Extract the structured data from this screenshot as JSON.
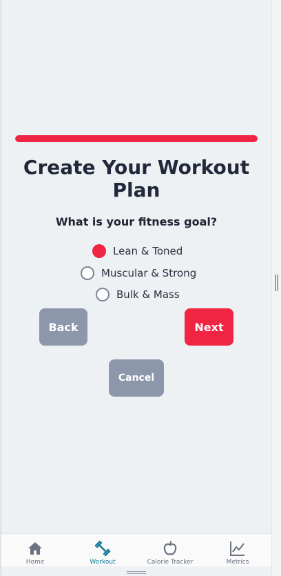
{
  "colors": {
    "accent": "#f02443",
    "muted_button": "#8c97ab",
    "active_nav": "#137a9b"
  },
  "progress": {
    "fraction": 1.0
  },
  "form": {
    "title": "Create Your Workout Plan",
    "question": "What is your fitness goal?",
    "options": [
      {
        "label": "Lean & Toned",
        "selected": true
      },
      {
        "label": "Muscular & Strong",
        "selected": false
      },
      {
        "label": "Bulk & Mass",
        "selected": false
      }
    ]
  },
  "buttons": {
    "back": "Back",
    "next": "Next",
    "cancel": "Cancel"
  },
  "nav": {
    "items": [
      {
        "label": "Home",
        "icon": "home-icon",
        "active": false
      },
      {
        "label": "Workout",
        "icon": "dumbbell-icon",
        "active": true
      },
      {
        "label": "Calorie Tracker",
        "icon": "apple-icon",
        "active": false
      },
      {
        "label": "Metrics",
        "icon": "chart-icon",
        "active": false
      }
    ]
  }
}
